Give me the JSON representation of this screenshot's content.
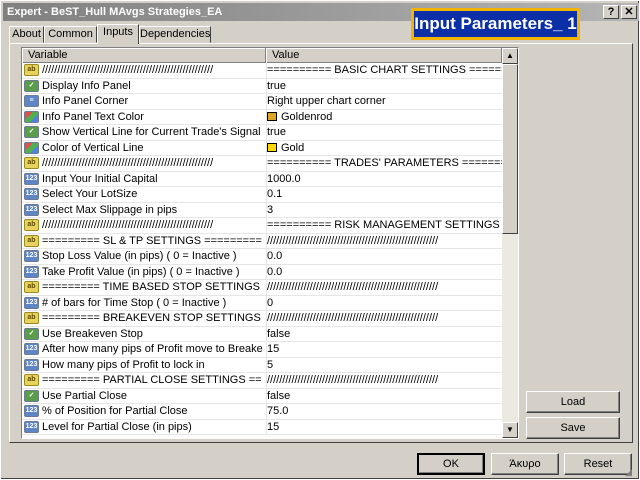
{
  "window": {
    "title": "Expert - BeST_Hull MAvgs Strategies_EA",
    "help_glyph": "?",
    "close_glyph": "✕"
  },
  "overlay_label": "Input Parameters_ 1",
  "tabs": [
    {
      "label": "About",
      "active": false
    },
    {
      "label": "Common",
      "active": false
    },
    {
      "label": "Inputs",
      "active": true
    },
    {
      "label": "Dependencies",
      "active": false
    }
  ],
  "grid": {
    "columns": [
      "Variable",
      "Value"
    ],
    "rows": [
      {
        "icon": "ab",
        "variable": "////////////////////////////////////////////////////////",
        "value": "========== BASIC CHART SETTINGS ==========..."
      },
      {
        "icon": "bool",
        "variable": "Display Info Panel",
        "value": "true"
      },
      {
        "icon": "list",
        "variable": "Info Panel Corner",
        "value": "Right upper chart corner"
      },
      {
        "icon": "color",
        "variable": "Info Panel Text Color",
        "value": "Goldenrod",
        "swatch": "#daa520"
      },
      {
        "icon": "bool",
        "variable": "Show Vertical Line for Current Trade's Signal Bar",
        "value": "true"
      },
      {
        "icon": "color",
        "variable": "Color of Vertical Line",
        "value": "Gold",
        "swatch": "#ffd700"
      },
      {
        "icon": "ab",
        "variable": "////////////////////////////////////////////////////////",
        "value": "========== TRADES' PARAMETERS ==========..."
      },
      {
        "icon": "num",
        "variable": "Input Your Initial Capital",
        "value": "1000.0"
      },
      {
        "icon": "num",
        "variable": "Select  Your LotSize",
        "value": "0.1"
      },
      {
        "icon": "num",
        "variable": "Select Max Slippage in pips",
        "value": "3"
      },
      {
        "icon": "ab",
        "variable": "////////////////////////////////////////////////////////",
        "value": "========== RISK MANAGEMENT SETTINGS  ===..."
      },
      {
        "icon": "ab",
        "variable": "=========  SL & TP  SETTINGS  ============...",
        "value": "////////////////////////////////////////////////////////"
      },
      {
        "icon": "num",
        "variable": "Stop Loss Value (in pips) ( 0 = Inactive )",
        "value": "0.0"
      },
      {
        "icon": "num",
        "variable": "Take Profit Value (in pips) ( 0 = Inactive )",
        "value": "0.0"
      },
      {
        "icon": "ab",
        "variable": "=========  TIME BASED STOP SETTINGS  ===...",
        "value": "////////////////////////////////////////////////////////"
      },
      {
        "icon": "num",
        "variable": "# of bars for Time Stop ( 0 = Inactive )",
        "value": "0"
      },
      {
        "icon": "ab",
        "variable": "=========  BREAKEVEN STOP SETTINGS  ===...",
        "value": "////////////////////////////////////////////////////////"
      },
      {
        "icon": "bool",
        "variable": "Use Breakeven Stop",
        "value": "false"
      },
      {
        "icon": "num",
        "variable": "After how many pips of Profit move to Breakeven",
        "value": "15"
      },
      {
        "icon": "num",
        "variable": "How many pips of Profit to lock in",
        "value": "5"
      },
      {
        "icon": "ab",
        "variable": "=========  PARTIAL CLOSE SETTINGS  ====...",
        "value": "////////////////////////////////////////////////////////"
      },
      {
        "icon": "bool",
        "variable": "Use Partial Close",
        "value": "false"
      },
      {
        "icon": "num",
        "variable": "% of Position for Partial Close",
        "value": "75.0"
      },
      {
        "icon": "num",
        "variable": "Level for Partial Close (in pips)",
        "value": "15"
      }
    ],
    "icon_glyphs": {
      "ab": "ab",
      "num": "123",
      "bool": "✓",
      "color": "",
      "list": "≡"
    }
  },
  "scroll": {
    "up": "▲",
    "down": "▼"
  },
  "buttons": {
    "load": "Load",
    "save": "Save",
    "ok": "OK",
    "cancel": "Άκυρο",
    "reset": "Reset"
  }
}
